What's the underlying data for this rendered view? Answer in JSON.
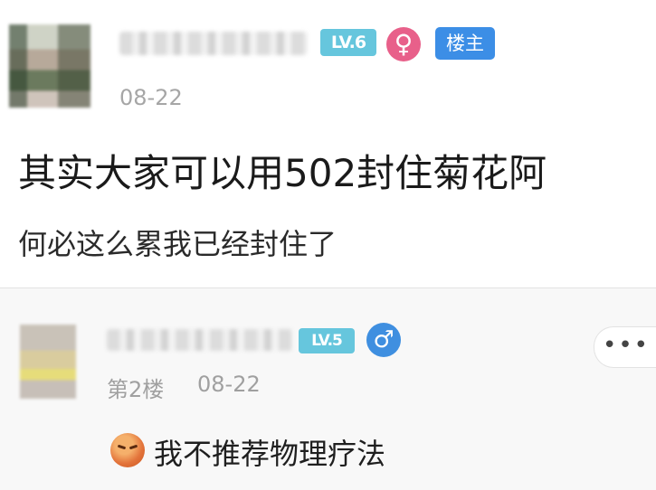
{
  "post": {
    "level": "LV.6",
    "gender_icon": "♀",
    "op_badge": "楼主",
    "date": "08-22",
    "title": "其实大家可以用502封住菊花阿",
    "body": "何必这么累我已经封住了"
  },
  "reply": {
    "level": "LV.5",
    "gender_icon": "♂",
    "floor": "第2楼",
    "date": "08-22",
    "more_label": "•••",
    "text": "我不推荐物理疗法"
  },
  "colors": {
    "level_badge": "#66c6dd",
    "female": "#e8608a",
    "male": "#3f8fe0",
    "op_badge": "#3c8ee6"
  }
}
